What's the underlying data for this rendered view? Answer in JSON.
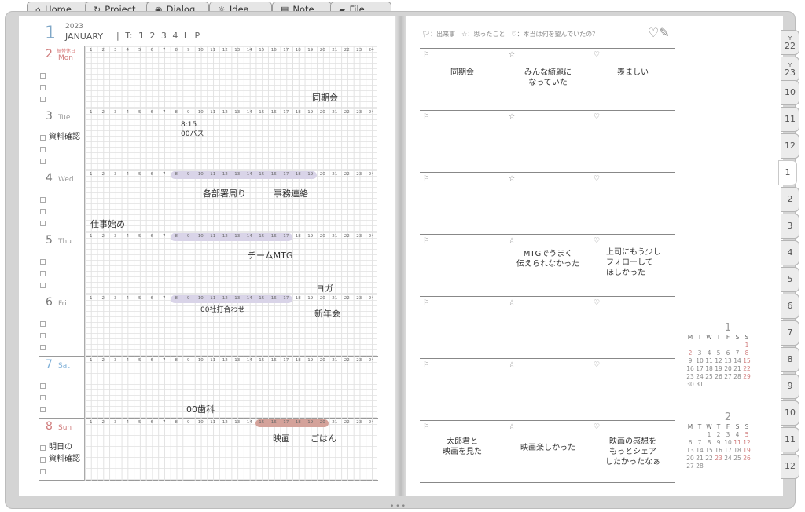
{
  "tabs": [
    {
      "label": "Home",
      "icon": "home-icon"
    },
    {
      "label": "Project",
      "icon": "project-icon"
    },
    {
      "label": "Dialog",
      "icon": "dialog-icon"
    },
    {
      "label": "Idea",
      "icon": "bulb-icon"
    },
    {
      "label": "Note",
      "icon": "note-icon"
    },
    {
      "label": "File",
      "icon": "folder-icon"
    }
  ],
  "header": {
    "month_number": "1",
    "year": "2023",
    "month_name": "JANUARY",
    "t_label": "| T:  1  2  3  4  L  P"
  },
  "days": [
    {
      "num": "2",
      "weekday": "Mon",
      "holiday": "振替休日",
      "color": "#d07c7c",
      "checklist": [
        "",
        "",
        ""
      ],
      "notes": [
        {
          "text": "同期会"
        }
      ]
    },
    {
      "num": "3",
      "weekday": "Tue",
      "checklist": [
        "資料確認",
        "",
        ""
      ],
      "notes": [
        {
          "text": "8:15"
        },
        {
          "text": "00バス"
        }
      ]
    },
    {
      "num": "4",
      "weekday": "Wed",
      "checklist": [
        "",
        "",
        ""
      ],
      "notes": [
        {
          "text": "各部署周り"
        },
        {
          "text": "事務連絡"
        },
        {
          "text": "仕事始め"
        }
      ]
    },
    {
      "num": "5",
      "weekday": "Thu",
      "checklist": [
        "",
        "",
        ""
      ],
      "notes": [
        {
          "text": "チームMTG"
        },
        {
          "text": "ヨガ"
        }
      ]
    },
    {
      "num": "6",
      "weekday": "Fri",
      "checklist": [
        "",
        "",
        ""
      ],
      "notes": [
        {
          "text": "00社打合わせ"
        },
        {
          "text": "新年会"
        }
      ]
    },
    {
      "num": "7",
      "weekday": "Sat",
      "color": "#7fb0d8",
      "checklist": [
        "",
        "",
        ""
      ],
      "notes": [
        {
          "text": "00歯科"
        }
      ]
    },
    {
      "num": "8",
      "weekday": "Sun",
      "color": "#d07c7c",
      "checklist": [
        "明日の",
        "資料確認",
        ""
      ],
      "notes": [
        {
          "text": "映画"
        },
        {
          "text": "ごはん"
        }
      ]
    }
  ],
  "hours": [
    "1",
    "2",
    "3",
    "4",
    "5",
    "6",
    "7",
    "8",
    "9",
    "10",
    "11",
    "12",
    "13",
    "14",
    "15",
    "16",
    "17",
    "18",
    "19",
    "20",
    "21",
    "22",
    "23",
    "24"
  ],
  "colors": {
    "purple_bar": "#d9d4e8",
    "red_bar": "#d4a29a",
    "sunday": "#d07c7c",
    "saturday": "#7fb0d8"
  },
  "right": {
    "legend": "🏳：出来事　☆：思ったこと　♡：本当は何を望んでいたの？",
    "logo_icon": "heart-pencil-icon",
    "rows": [
      [
        "同期会",
        "みんな綺麗に\nなっていた",
        "羨ましい"
      ],
      [
        "",
        "",
        ""
      ],
      [
        "",
        "",
        ""
      ],
      [
        "",
        "MTGでうまく\n伝えられなかった",
        "上司にもう少し\nフォローして\nほしかった"
      ],
      [
        "",
        "",
        ""
      ],
      [
        "",
        "",
        ""
      ],
      [
        "太郎君と\n映画を見た",
        "映画楽しかった",
        "映画の感想を\nもっとシェア\nしたかったなぁ"
      ]
    ]
  },
  "month_tabs": [
    {
      "label": "22",
      "prefix": "Y"
    },
    {
      "label": "23",
      "prefix": "Y"
    },
    {
      "label": "10"
    },
    {
      "label": "11"
    },
    {
      "label": "12"
    },
    {
      "label": "1",
      "active": true
    },
    {
      "label": "2"
    },
    {
      "label": "3"
    },
    {
      "label": "4"
    },
    {
      "label": "5"
    },
    {
      "label": "6"
    },
    {
      "label": "7"
    },
    {
      "label": "8"
    },
    {
      "label": "9"
    },
    {
      "label": "10"
    },
    {
      "label": "11"
    },
    {
      "label": "12"
    }
  ],
  "mini_calendars": [
    {
      "month": "1",
      "weekdays": [
        "M",
        "T",
        "W",
        "T",
        "F",
        "S",
        "S"
      ],
      "weeks": [
        [
          "",
          "",
          "",
          "",
          "",
          "",
          "1"
        ],
        [
          "2",
          "3",
          "4",
          "5",
          "6",
          "7",
          "8"
        ],
        [
          "9",
          "10",
          "11",
          "12",
          "13",
          "14",
          "15"
        ],
        [
          "16",
          "17",
          "18",
          "19",
          "20",
          "21",
          "22"
        ],
        [
          "23",
          "24",
          "25",
          "26",
          "27",
          "28",
          "29"
        ],
        [
          "30",
          "31",
          "",
          "",
          "",
          "",
          ""
        ]
      ]
    },
    {
      "month": "2",
      "weekdays": [
        "M",
        "T",
        "W",
        "T",
        "F",
        "S",
        "S"
      ],
      "weeks": [
        [
          "",
          "",
          "1",
          "2",
          "3",
          "4",
          "5"
        ],
        [
          "6",
          "7",
          "8",
          "9",
          "10",
          "11",
          "12"
        ],
        [
          "13",
          "14",
          "15",
          "16",
          "17",
          "18",
          "19"
        ],
        [
          "20",
          "21",
          "22",
          "23",
          "24",
          "25",
          "26"
        ],
        [
          "27",
          "28",
          "",
          "",
          "",
          "",
          ""
        ]
      ]
    }
  ]
}
